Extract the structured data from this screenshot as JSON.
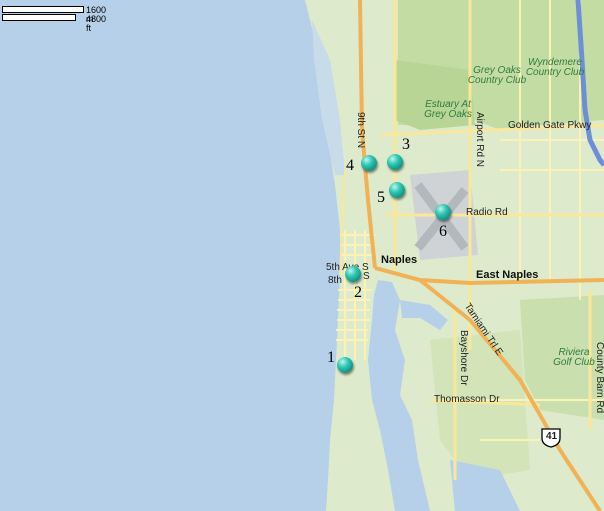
{
  "map": {
    "scale": {
      "metric": "1600 m",
      "imperial": "4800 ft"
    },
    "places": {
      "city": "Naples",
      "east_naples": "East Naples",
      "grey_oaks": "Grey Oaks Country Club",
      "wyndemere": "Wyndemere Country Club",
      "estuary": "Estuary At Grey Oaks",
      "riviera": "Riviera Golf Club"
    },
    "roads": {
      "golden_gate": "Golden Gate Pkwy",
      "radio": "Radio Rd",
      "fifth_ave": "5th Ave S",
      "eighth": "8th",
      "eighth_s": "S",
      "ninth": "9th St N",
      "airport": "Airport Rd N",
      "tamiami": "Tamiami Trl E",
      "bayshore": "Bayshore Dr",
      "thomasson": "Thomasson Dr",
      "county_barn": "County Barn Rd",
      "route_shield": "41"
    },
    "markers": [
      {
        "id": "1",
        "label": "1"
      },
      {
        "id": "2",
        "label": "2"
      },
      {
        "id": "3",
        "label": "3"
      },
      {
        "id": "4",
        "label": "4"
      },
      {
        "id": "5",
        "label": "5"
      },
      {
        "id": "6",
        "label": "6"
      }
    ],
    "colors": {
      "water": "#b5d0e8",
      "land": "#ddeacb",
      "park": "#c3dca3",
      "major_road": "#f0b254",
      "road": "#fdf2b5",
      "highway": "#6e8fd8",
      "marker": "#1fae9c"
    }
  }
}
